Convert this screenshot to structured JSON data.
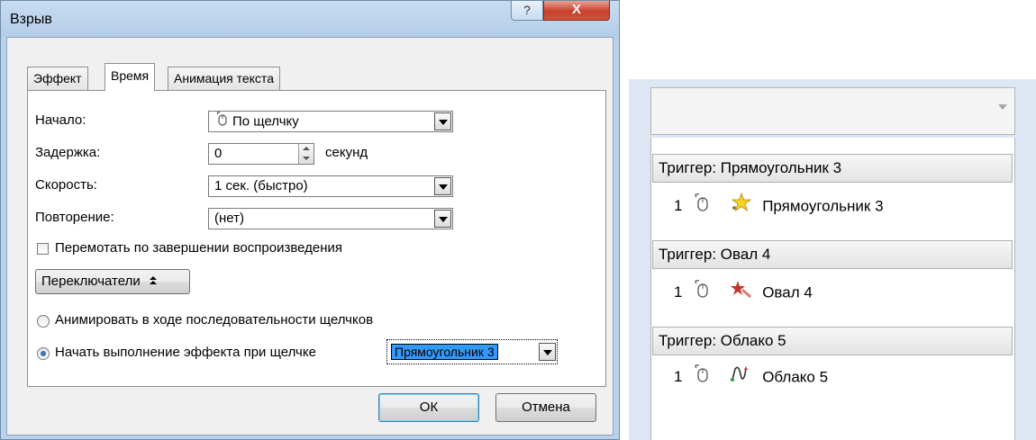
{
  "dialog": {
    "title": "Взрыв",
    "help_label": "?",
    "close_label": "X",
    "tabs": [
      {
        "label": "Эффект"
      },
      {
        "label": "Время"
      },
      {
        "label": "Анимация текста"
      }
    ],
    "start": {
      "label": "Начало:",
      "value": "По щелчку"
    },
    "delay": {
      "label": "Задержка:",
      "value": "0",
      "unit": "секунд"
    },
    "speed": {
      "label": "Скорость:",
      "value": "1 сек. (быстро)"
    },
    "repeat": {
      "label": "Повторение:",
      "value": "(нет)"
    },
    "rewind": {
      "label": "Перемотать по завершении воспроизведения",
      "checked": false
    },
    "triggers_button": {
      "label": "Переключатели",
      "icon": "double-chevron-up-icon"
    },
    "radio_animate": {
      "label": "Анимировать в ходе последовательности щелчков",
      "checked": false
    },
    "radio_start_on_click": {
      "label": "Начать выполнение эффекта при щелчке",
      "checked": true
    },
    "trigger_object": {
      "value": "Прямоугольник 3"
    },
    "ok_label": "ОК",
    "cancel_label": "Отмена"
  },
  "animation_pane": {
    "triggers": [
      {
        "header": "Триггер: Прямоугольник 3",
        "number": "1",
        "effect_icon": "explode-star-icon",
        "item": "Прямоугольник 3"
      },
      {
        "header": "Триггер: Овал 4",
        "number": "1",
        "effect_icon": "burst-star-icon",
        "item": "Овал 4"
      },
      {
        "header": "Триггер: Облако 5",
        "number": "1",
        "effect_icon": "motion-path-icon",
        "item": "Облако 5"
      }
    ]
  },
  "colors": {
    "window_frame": "#b9d1ea",
    "close_button": "#c7402c",
    "selection": "#3399ff"
  }
}
